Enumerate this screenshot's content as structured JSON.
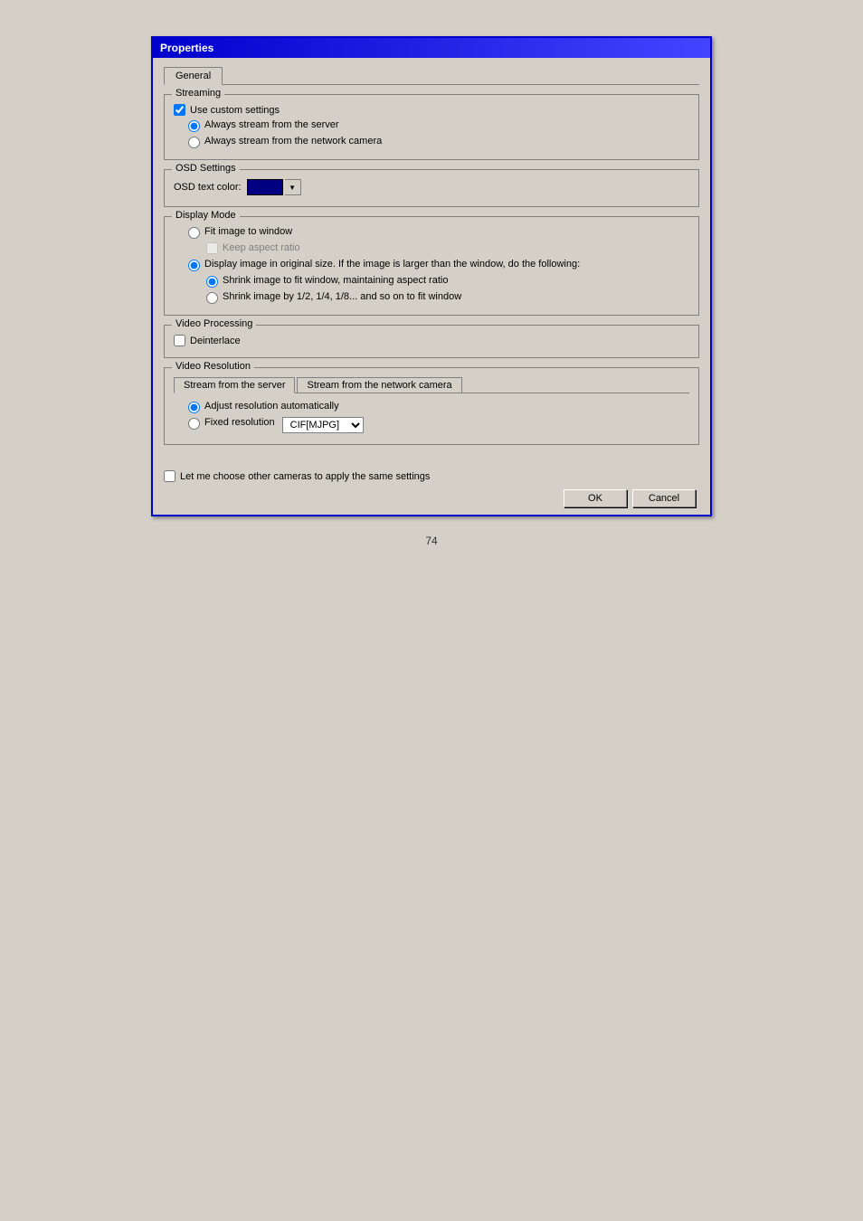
{
  "window": {
    "title": "Properties"
  },
  "tabs": {
    "general": {
      "label": "General",
      "active": true
    }
  },
  "streaming": {
    "group_label": "Streaming",
    "use_custom_label": "Use custom settings",
    "use_custom_checked": true,
    "always_server_label": "Always stream from the server",
    "always_server_checked": true,
    "always_camera_label": "Always stream from the network camera",
    "always_camera_checked": false
  },
  "osd": {
    "group_label": "OSD Settings",
    "text_color_label": "OSD text color:"
  },
  "display_mode": {
    "group_label": "Display Mode",
    "fit_image_label": "Fit image to window",
    "fit_image_checked": false,
    "keep_aspect_label": "Keep aspect ratio",
    "keep_aspect_checked": false,
    "display_original_label": "Display image in original size. If the image is larger than the window, do the following:",
    "display_original_checked": true,
    "shrink_fit_label": "Shrink image to fit window, maintaining aspect ratio",
    "shrink_fit_checked": true,
    "shrink_half_label": "Shrink image by 1/2, 1/4, 1/8... and so on to fit window",
    "shrink_half_checked": false
  },
  "video_processing": {
    "group_label": "Video Processing",
    "deinterlace_label": "Deinterlace",
    "deinterlace_checked": false
  },
  "video_resolution": {
    "group_label": "Video Resolution",
    "sub_tab_server": "Stream from the server",
    "sub_tab_camera": "Stream from the network camera",
    "adjust_auto_label": "Adjust resolution automatically",
    "adjust_auto_checked": true,
    "fixed_res_label": "Fixed resolution",
    "fixed_res_checked": false,
    "resolution_value": "CIF[MJPG]"
  },
  "footer": {
    "let_me_choose_label": "Let me choose other cameras to apply the same settings",
    "let_me_choose_checked": false,
    "ok_label": "OK",
    "cancel_label": "Cancel"
  },
  "page_number": "74"
}
